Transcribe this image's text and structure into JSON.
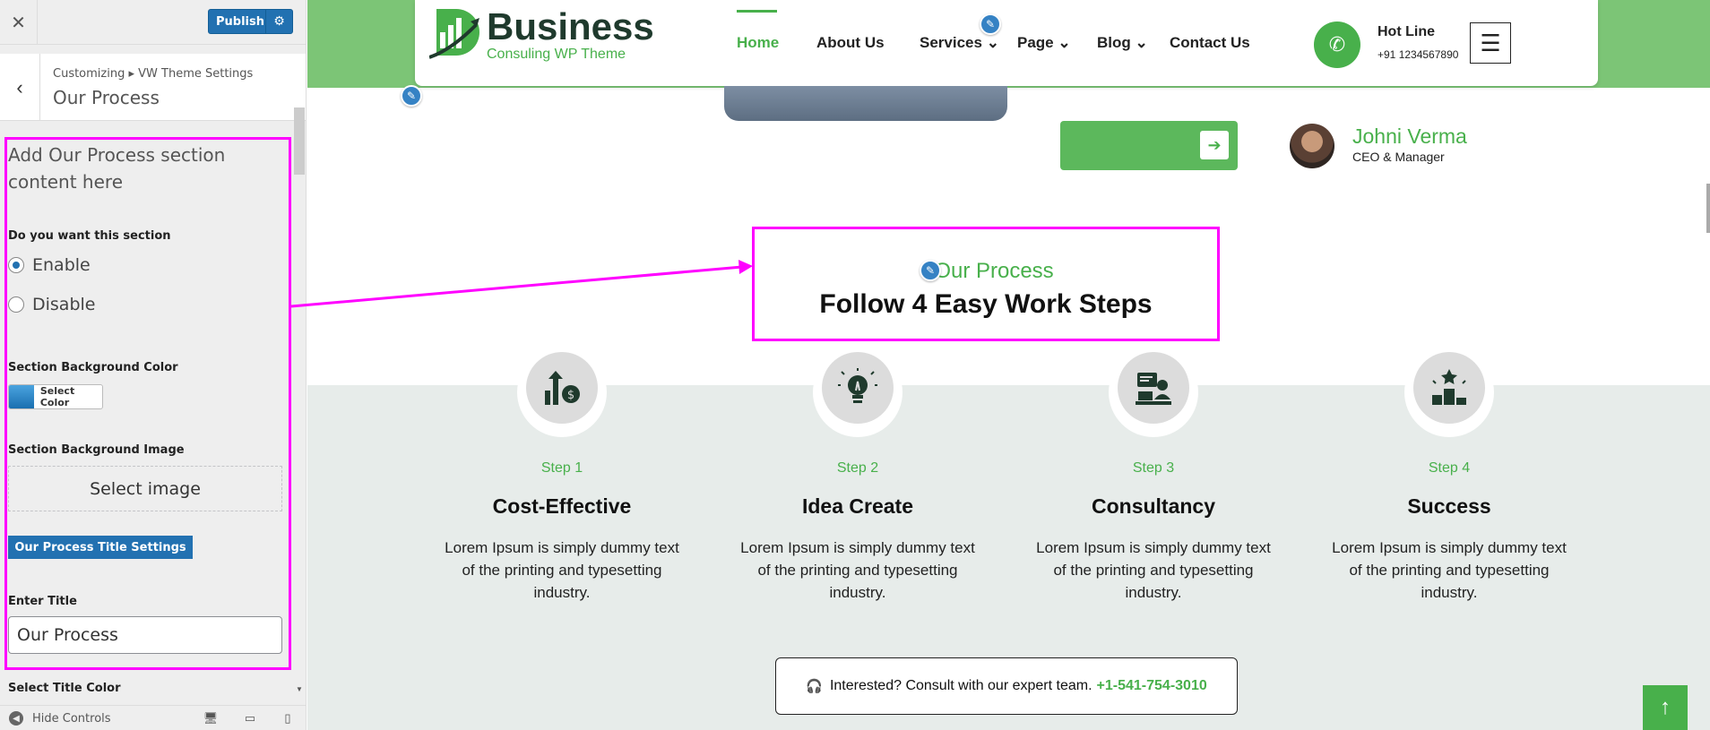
{
  "customizer": {
    "close_icon": "close-icon",
    "publish_label": "Publish",
    "breadcrumb": "Customizing ▸ VW Theme Settings",
    "section_title": "Our Process",
    "description": "Add Our Process section content here",
    "toggle_label": "Do you want this section",
    "enable_label": "Enable",
    "disable_label": "Disable",
    "enable_checked": true,
    "bg_color_label": "Section Background Color",
    "select_color_label": "Select Color",
    "bg_image_label": "Section Background Image",
    "select_image_label": "Select image",
    "title_settings_label": "Our Process Title Settings",
    "enter_title_label": "Enter Title",
    "title_value": "Our Process",
    "title_color_label": "Select Title Color",
    "hide_controls_label": "Hide Controls"
  },
  "site": {
    "logo_word": "Business",
    "logo_tagline": "Consuling WP Theme",
    "nav": [
      "Home",
      "About Us",
      "Services",
      "Page",
      "Blog",
      "Contact Us"
    ],
    "hotline_label": "Hot Line",
    "hotline_number": "+91 1234567890",
    "ceo_name": "Johni Verma",
    "ceo_role": "CEO & Manager",
    "process_subtitle": "Our Process",
    "process_title": "Follow 4 Easy Work Steps",
    "steps": [
      {
        "num": "Step 1",
        "name": "Cost-Effective",
        "desc": "Lorem Ipsum is simply dummy text of the printing and typesetting industry.",
        "icon": "growth-money-icon"
      },
      {
        "num": "Step 2",
        "name": "Idea Create",
        "desc": "Lorem Ipsum is simply dummy text of the printing and typesetting industry.",
        "icon": "lightbulb-icon"
      },
      {
        "num": "Step 3",
        "name": "Consultancy",
        "desc": "Lorem Ipsum is simply dummy text of the printing and typesetting industry.",
        "icon": "consultant-icon"
      },
      {
        "num": "Step 4",
        "name": "Success",
        "desc": "Lorem Ipsum is simply dummy text of the printing and typesetting industry.",
        "icon": "podium-star-icon"
      }
    ],
    "consult_text": "Interested? Consult with our expert team.",
    "consult_phone": "+1-541-754-3010"
  },
  "colors": {
    "brand_green": "#48b04b",
    "header_band": "#7cc576",
    "wp_blue": "#2271b1",
    "annotation": "#ff00ff"
  }
}
